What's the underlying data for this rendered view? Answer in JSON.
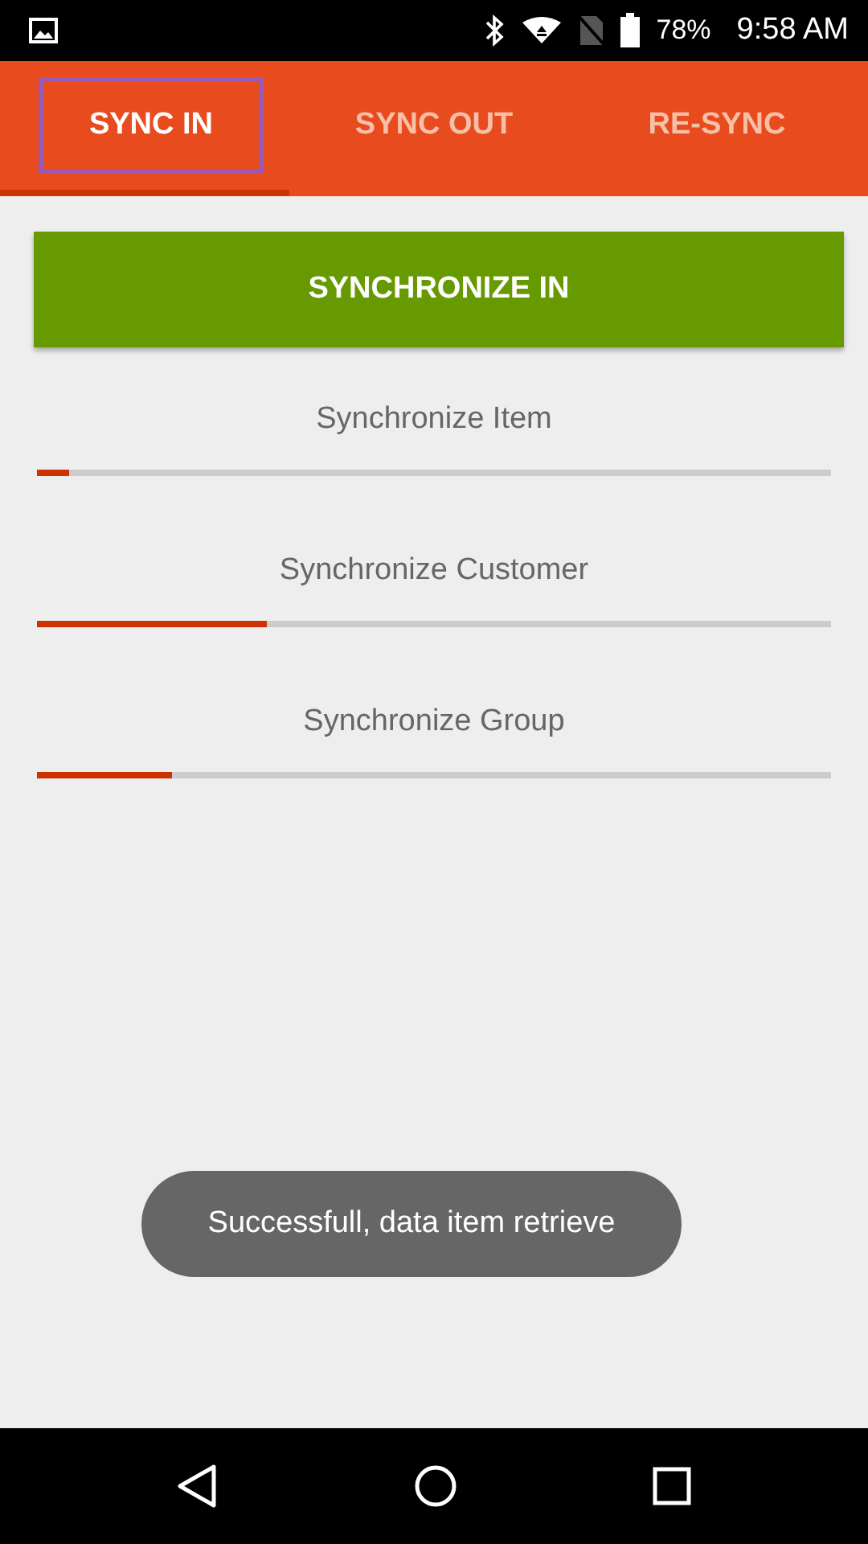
{
  "status_bar": {
    "battery": "78%",
    "time": "9:58 AM"
  },
  "tabs": [
    {
      "label": "SYNC IN",
      "selected": true
    },
    {
      "label": "SYNC OUT",
      "selected": false
    },
    {
      "label": "RE-SYNC",
      "selected": false
    }
  ],
  "sync_button": "SYNCHRONIZE IN",
  "progress": [
    {
      "label": "Synchronize Item",
      "level": 0.04
    },
    {
      "label": "Synchronize Customer",
      "level": 0.29
    },
    {
      "label": "Synchronize Group",
      "level": 0.17
    }
  ],
  "toast": "Successfull, data item retrieve"
}
